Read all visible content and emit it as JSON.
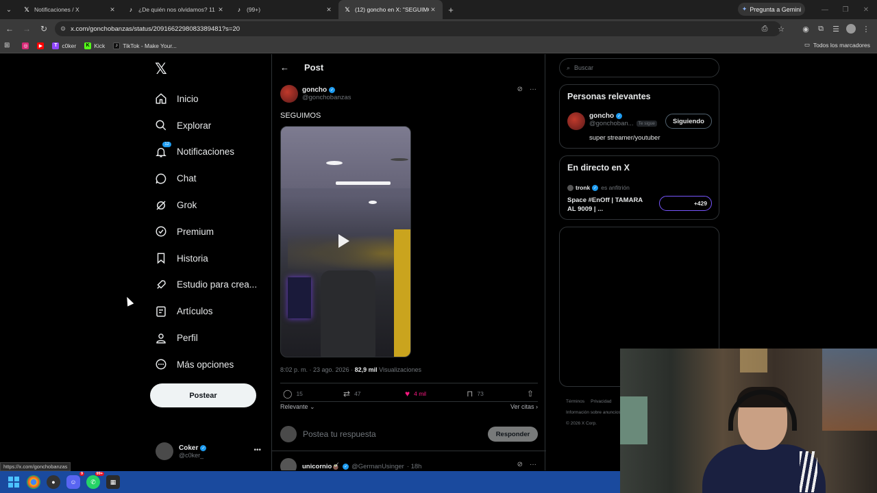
{
  "browser": {
    "tabs": [
      {
        "title": "Notificaciones / X",
        "icon": "x-logo-icon"
      },
      {
        "title": "¿De quién nos olvidamos? 11 ...",
        "icon": "tiktok-icon"
      },
      {
        "title": "(99+)",
        "icon": "tiktok-icon"
      },
      {
        "title": "(12) goncho en X: \"SEGUIMOS ...",
        "icon": "x-logo-icon"
      }
    ],
    "gemini_label": "Pregunta a Gemini",
    "url": "x.com/gonchobanzas/status/2091662298083389481?s=20",
    "bookmarks": [
      {
        "label": "",
        "icon": "instagram-icon",
        "color": "#d62976"
      },
      {
        "label": "",
        "icon": "youtube-icon",
        "color": "#ff0000"
      },
      {
        "label": "c0ker",
        "icon": "twitch-icon",
        "color": "#9146ff"
      },
      {
        "label": "Kick",
        "icon": "kick-icon",
        "color": "#53fc18"
      },
      {
        "label": "TikTok - Make Your...",
        "icon": "tiktok-icon",
        "color": "#111111"
      }
    ],
    "all_bookmarks_label": "Todos los marcadores",
    "status_url": "https://x.com/gonchobanzas"
  },
  "sidebar": {
    "items": [
      {
        "label": "Inicio",
        "icon": "home-icon"
      },
      {
        "label": "Explorar",
        "icon": "search-icon"
      },
      {
        "label": "Notificaciones",
        "icon": "bell-icon",
        "badge": "12"
      },
      {
        "label": "Chat",
        "icon": "chat-icon"
      },
      {
        "label": "Grok",
        "icon": "grok-icon"
      },
      {
        "label": "Premium",
        "icon": "verified-icon"
      },
      {
        "label": "Historia",
        "icon": "bookmark-icon"
      },
      {
        "label": "Estudio para crea...",
        "icon": "rocket-icon"
      },
      {
        "label": "Artículos",
        "icon": "article-icon"
      },
      {
        "label": "Perfil",
        "icon": "person-icon"
      },
      {
        "label": "Más opciones",
        "icon": "more-circle-icon"
      }
    ],
    "post_button": "Postear",
    "account": {
      "name": "Coker",
      "handle": "@c0ker_"
    }
  },
  "post": {
    "header_title": "Post",
    "author_name": "goncho",
    "author_handle": "@gonchobanzas",
    "text": "SEGUIMOS",
    "time": "8:02 p. m. · 23 ago. 2026 · ",
    "views_count": "82,9 mil",
    "views_label": " Visualizaciones",
    "replies": "15",
    "reposts": "47",
    "likes": "4 mil",
    "bookmarks": "73",
    "sort_label": "Relevante",
    "quotes_label": "Ver citas",
    "reply_placeholder": "Postea tu respuesta",
    "reply_button": "Responder",
    "first_reply": {
      "name": "unicornio🧉",
      "handle": "@GermanUsinger",
      "time": "· 18h"
    }
  },
  "right": {
    "search_placeholder": "Buscar",
    "relevant_title": "Personas relevantes",
    "relevant_user": {
      "name": "goncho",
      "handle": "@gonchoban...",
      "follows_you": "Te sigue",
      "bio": "super streamer/youtuber",
      "button": "Siguiendo"
    },
    "live_title": "En directo en X",
    "live": {
      "host": "tronk",
      "role": "es anfitrión",
      "title": "Space #EnOff | TAMARA AL 9009 | ...",
      "listeners": "+429"
    },
    "footer": [
      "Términos",
      "Privacidad",
      "Información sobre anuncios",
      "© 2026 X Corp."
    ]
  },
  "accent": "#1d9bf0",
  "like_color": "#f91880"
}
